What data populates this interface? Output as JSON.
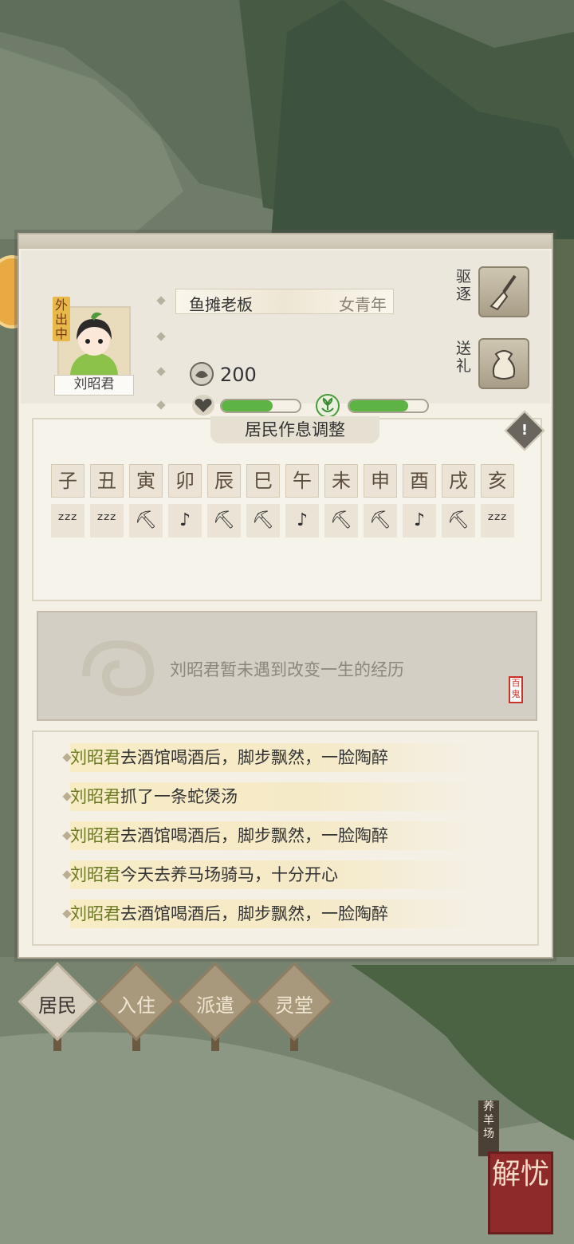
{
  "resident": {
    "status_tag": "外出中",
    "name": "刘昭君",
    "job": "鱼摊老板",
    "age_group": "女青年",
    "money": "200",
    "health_fraction": 0.65,
    "mood_fraction": 0.75
  },
  "actions": {
    "expel_label": "驱逐",
    "gift_label": "送礼",
    "expel_icon": "broom-icon",
    "gift_icon": "pouch-icon"
  },
  "schedule": {
    "title": "居民作息调整",
    "hours": [
      "子",
      "丑",
      "寅",
      "卯",
      "辰",
      "巳",
      "午",
      "未",
      "申",
      "酉",
      "戌",
      "亥"
    ],
    "activities": [
      "sleep",
      "sleep",
      "work",
      "rest",
      "work",
      "work",
      "rest",
      "work",
      "work",
      "rest",
      "work",
      "sleep"
    ]
  },
  "event": {
    "text": "刘昭君暂未遇到改变一生的经历",
    "seal": "百鬼"
  },
  "log": [
    {
      "name": "刘昭君",
      "text": "去酒馆喝酒后，脚步飘然，一脸陶醉"
    },
    {
      "name": "刘昭君",
      "text": "抓了一条蛇煲汤"
    },
    {
      "name": "刘昭君",
      "text": "去酒馆喝酒后，脚步飘然，一脸陶醉"
    },
    {
      "name": "刘昭君",
      "text": "今天去养马场骑马，十分开心"
    },
    {
      "name": "刘昭君",
      "text": "去酒馆喝酒后，脚步飘然，一脸陶醉"
    }
  ],
  "tabs": [
    {
      "label": "居民",
      "active": true
    },
    {
      "label": "入住",
      "active": false
    },
    {
      "label": "派遣",
      "active": false
    },
    {
      "label": "灵堂",
      "active": false
    }
  ],
  "map": {
    "farm_label": "养羊场",
    "jieyou_label": "解忧"
  },
  "colors": {
    "bar_green": "#5db343",
    "name_green": "#6a7a23",
    "panel_bg": "#f4f0e6"
  }
}
